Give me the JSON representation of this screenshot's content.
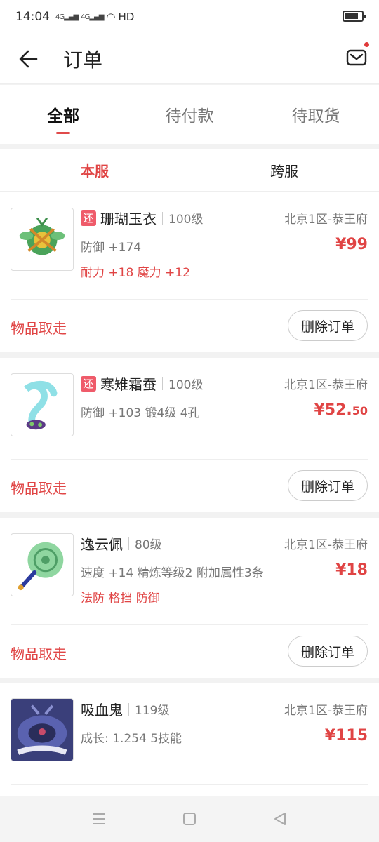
{
  "status_bar": {
    "time": "14:04",
    "signal1": "4G",
    "signal2": "4G",
    "hd": "HD"
  },
  "header": {
    "title": "订单",
    "back_icon": "back-arrow-icon",
    "mail_icon": "mail-icon"
  },
  "tabs": [
    {
      "label": "全部",
      "active": true
    },
    {
      "label": "待付款",
      "active": false
    },
    {
      "label": "待取货",
      "active": false
    }
  ],
  "subtabs": [
    {
      "label": "本服",
      "active": true
    },
    {
      "label": "跨服",
      "active": false
    }
  ],
  "orders": [
    {
      "badge": "还",
      "name": "珊瑚玉衣",
      "level": "100级",
      "server": "北京1区-恭王府",
      "attr1": "防御 +174",
      "attr2": "耐力 +18 魔力 +12",
      "price_int": "¥99",
      "price_dec": "",
      "pickup": "物品取走",
      "delete": "删除订单"
    },
    {
      "badge": "还",
      "name": "寒雉霜蚕",
      "level": "100级",
      "server": "北京1区-恭王府",
      "attr1": "防御 +103  锻4级  4孔",
      "attr2": "",
      "price_int": "¥52.",
      "price_dec": "50",
      "pickup": "物品取走",
      "delete": "删除订单"
    },
    {
      "badge": "",
      "name": "逸云佩",
      "level": "80级",
      "server": "北京1区-恭王府",
      "attr1": "速度 +14  精炼等级2  附加属性3条",
      "attr2": "法防 格挡 防御",
      "price_int": "¥18",
      "price_dec": "",
      "pickup": "物品取走",
      "delete": "删除订单"
    },
    {
      "badge": "",
      "name": "吸血鬼",
      "level": "119级",
      "server": "北京1区-恭王府",
      "attr1": "成长: 1.254  5技能",
      "attr2": "",
      "price_int": "¥115",
      "price_dec": "",
      "pickup": "",
      "delete": ""
    }
  ],
  "colors": {
    "accent": "#e04444",
    "badge": "#ef5b6a"
  }
}
